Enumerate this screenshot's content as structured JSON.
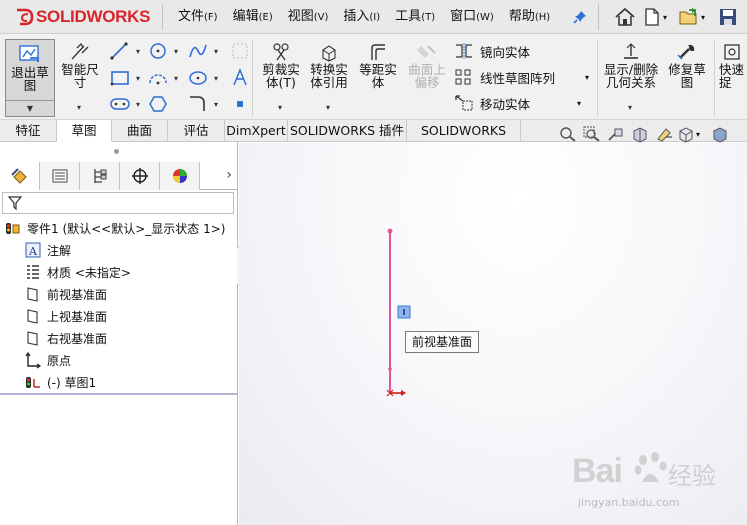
{
  "app": {
    "name": "SOLIDWORKS",
    "brand_color": "#d8262c"
  },
  "menu": [
    {
      "label": "文件",
      "key": "(F)"
    },
    {
      "label": "编辑",
      "key": "(E)"
    },
    {
      "label": "视图",
      "key": "(V)"
    },
    {
      "label": "插入",
      "key": "(I)"
    },
    {
      "label": "工具",
      "key": "(T)"
    },
    {
      "label": "窗口",
      "key": "(W)"
    },
    {
      "label": "帮助",
      "key": "(H)"
    }
  ],
  "quick_access": [
    "home-icon",
    "new-document-icon",
    "open-folder-icon",
    "save-icon"
  ],
  "commands": {
    "exit_sketch": "退出草\n图",
    "smart_dimension": "智能尺\n寸",
    "trim": "剪裁实\n体(T)",
    "convert": "转换实\n体引用",
    "offset": "等距实\n体",
    "surface_offset": "曲面上\n偏移",
    "mirror": "镜向实体",
    "linear_pattern": "线性草图阵列",
    "move": "移动实体",
    "display_relations": "显示/删除\n几何关系",
    "repair": "修复草\n图",
    "quick_snap": "快速\n捉"
  },
  "tabs": [
    {
      "label": "特征",
      "active": false
    },
    {
      "label": "草图",
      "active": true
    },
    {
      "label": "曲面",
      "active": false
    },
    {
      "label": "评估",
      "active": false
    },
    {
      "label": "DimXpert",
      "active": false
    },
    {
      "label": "SOLIDWORKS 插件",
      "active": false
    },
    {
      "label": "SOLIDWORKS MBD",
      "active": false
    }
  ],
  "feature_tree": {
    "items": [
      {
        "label": "零件1 (默认<<默认>_显示状态 1>)",
        "icon": "part-icon"
      },
      {
        "label": "注解",
        "icon": "annotation-icon"
      },
      {
        "label": "材质 <未指定>",
        "icon": "material-icon"
      },
      {
        "label": "前视基准面",
        "icon": "plane-icon"
      },
      {
        "label": "上视基准面",
        "icon": "plane-icon"
      },
      {
        "label": "右视基准面",
        "icon": "plane-icon"
      },
      {
        "label": "原点",
        "icon": "origin-icon"
      },
      {
        "label": "(-) 草图1",
        "icon": "sketch-icon"
      }
    ]
  },
  "graphics": {
    "tooltip": "前视基准面",
    "sketch_line_color": "#e0559a"
  },
  "watermark": {
    "brand": "Bai",
    "brand_cn": "经验",
    "url": "jingyan.baidu.com"
  }
}
